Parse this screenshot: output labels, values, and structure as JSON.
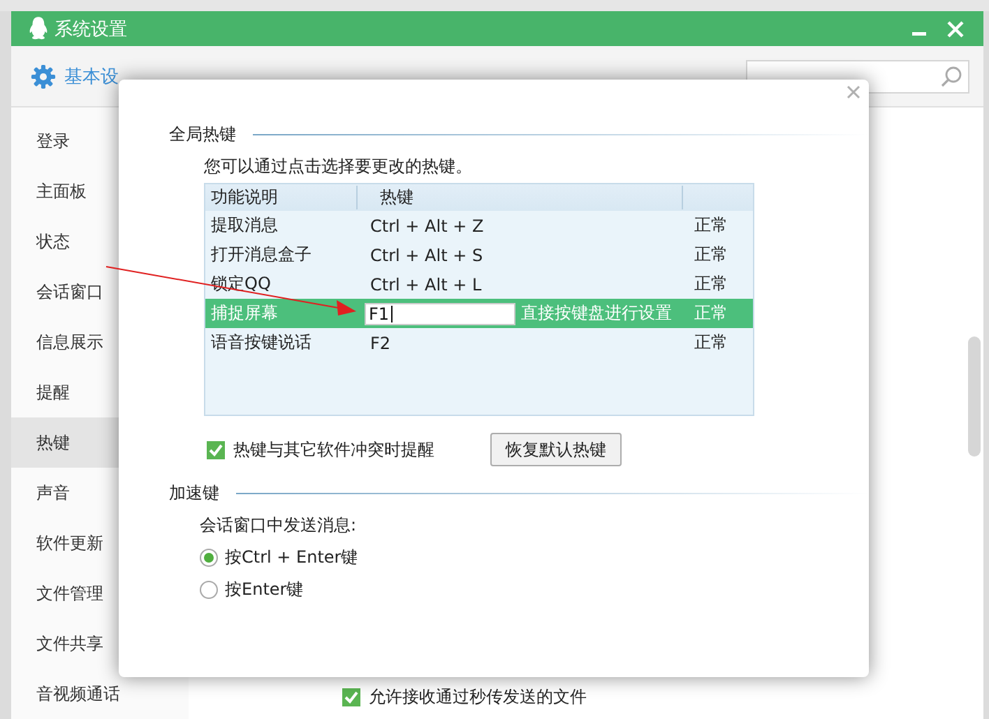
{
  "window": {
    "title": "系统设置"
  },
  "toolbar": {
    "tabs": [
      {
        "label": "基本设",
        "selected": true
      }
    ]
  },
  "sidebar": {
    "items": [
      {
        "label": "登录",
        "selected": false
      },
      {
        "label": "主面板",
        "selected": false
      },
      {
        "label": "状态",
        "selected": false
      },
      {
        "label": "会话窗口",
        "selected": false
      },
      {
        "label": "信息展示",
        "selected": false
      },
      {
        "label": "提醒",
        "selected": false
      },
      {
        "label": "热键",
        "selected": true
      },
      {
        "label": "声音",
        "selected": false
      },
      {
        "label": "软件更新",
        "selected": false
      },
      {
        "label": "文件管理",
        "selected": false
      },
      {
        "label": "文件共享",
        "selected": false
      },
      {
        "label": "音视频通话",
        "selected": false
      }
    ]
  },
  "background_option": {
    "label": "允许接收通过秒传发送的文件",
    "checked": true
  },
  "dialog": {
    "hotkeys": {
      "title": "全局热键",
      "description": "您可以通过点击选择要更改的热键。",
      "columns": [
        "功能说明",
        "热键"
      ],
      "rows": [
        {
          "name": "提取消息",
          "hotkey": "Ctrl + Alt + Z",
          "status": "正常",
          "selected": false
        },
        {
          "name": "打开消息盒子",
          "hotkey": "Ctrl + Alt + S",
          "status": "正常",
          "selected": false
        },
        {
          "name": "锁定QQ",
          "hotkey": "Ctrl + Alt + L",
          "status": "正常",
          "selected": false
        },
        {
          "name": "捕捉屏幕",
          "hotkey": "F1",
          "hint": "直接按键盘进行设置",
          "status": "正常",
          "selected": true
        },
        {
          "name": "语音按键说话",
          "hotkey": "F2",
          "status": "正常",
          "selected": false
        }
      ],
      "conflict_option": {
        "label": "热键与其它软件冲突时提醒",
        "checked": true
      },
      "restore_button": "恢复默认热键"
    },
    "accelerator": {
      "title": "加速键",
      "label": "会话窗口中发送消息:",
      "options": [
        {
          "label": "按Ctrl + Enter键",
          "selected": true
        },
        {
          "label": "按Enter键",
          "selected": false
        }
      ]
    }
  }
}
